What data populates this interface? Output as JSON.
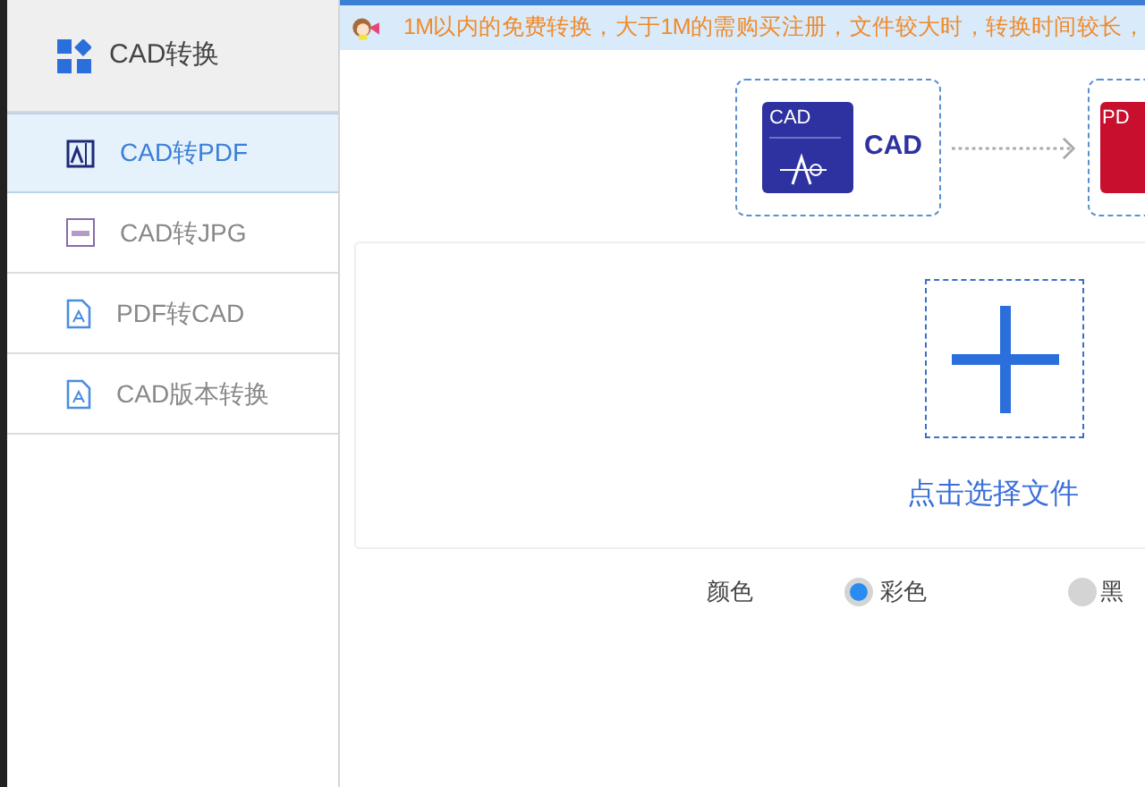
{
  "sidebar": {
    "header": {
      "label": "CAD转换"
    },
    "items": [
      {
        "label": "CAD转PDF",
        "kind": "cad",
        "selected": true
      },
      {
        "label": "CAD转JPG",
        "kind": "jpg",
        "selected": false
      },
      {
        "label": "PDF转CAD",
        "kind": "pdf",
        "selected": false
      },
      {
        "label": "CAD版本转换",
        "kind": "pdf",
        "selected": false
      }
    ]
  },
  "notice": "1M以内的免费转换，大于1M的需购买注册，文件较大时，转换时间较长，",
  "formats": [
    {
      "kind": "cad",
      "badge": "CAD",
      "label": "CAD"
    },
    {
      "kind": "pdf",
      "badge": "PD"
    }
  ],
  "upload": {
    "label": "点击选择文件"
  },
  "color_option": {
    "label": "颜色",
    "options": [
      {
        "label": "彩色",
        "selected": true
      },
      {
        "label": "黑",
        "selected": false
      }
    ]
  }
}
